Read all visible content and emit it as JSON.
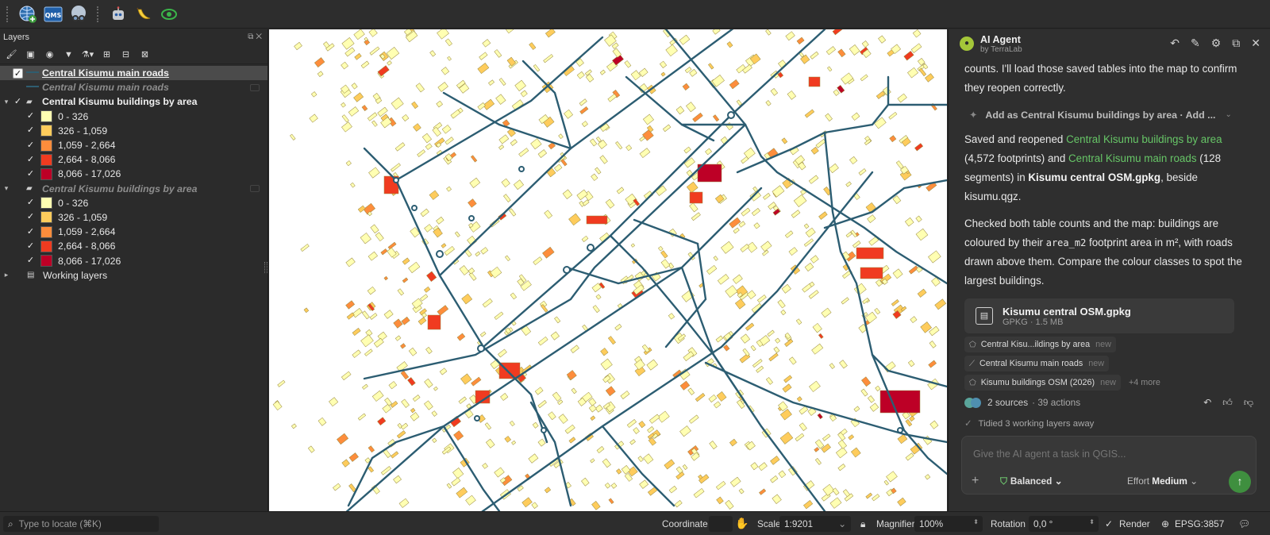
{
  "toolbar": {
    "icons": [
      "globe-add-icon",
      "qms-icon",
      "sphere-binoculars-icon",
      "robot-icon",
      "banana-icon",
      "eye-target-icon"
    ],
    "qms_text": "QMS"
  },
  "layers_panel": {
    "title": "Layers",
    "tree": [
      {
        "label": "Central Kisumu main roads",
        "checked": true,
        "style": "selected"
      },
      {
        "label": "Central Kisumu main roads",
        "checked": false,
        "style": "ghost"
      },
      {
        "label": "Central Kisumu buildings by area",
        "checked": true,
        "style": "bold"
      },
      {
        "label": "Central Kisumu buildings by area",
        "checked": false,
        "style": "ghost"
      },
      {
        "label": "Working layers"
      }
    ],
    "classes": [
      {
        "label": "0 - 326",
        "color": "#ffffb2"
      },
      {
        "label": "326 - 1,059",
        "color": "#fecc5c"
      },
      {
        "label": "1,059 - 2,664",
        "color": "#fd8d3c"
      },
      {
        "label": "2,664 - 8,066",
        "color": "#f03b20"
      },
      {
        "label": "8,066 - 17,026",
        "color": "#bd0026"
      }
    ]
  },
  "agent": {
    "name": "AI Agent",
    "by": "by TerraLab",
    "intro": "counts. I'll load those saved tables into the map to confirm they reopen correctly.",
    "tool_step": "Add as Central Kisumu buildings by area · Add ...",
    "msg1": {
      "p1": "Saved and reopened ",
      "link1": "Central Kisumu buildings by area",
      "p2": " (4,572 footprints) and ",
      "link2": "Central Kisumu main roads",
      "p3": " (128 segments) in ",
      "file": "Kisumu central OSM.gpkg",
      "p4": ", beside kisumu.qgz."
    },
    "msg2": {
      "p1": "Checked both table counts and the map: buildings are coloured by their ",
      "code": "area_m2",
      "p2": " footprint area in m², with roads drawn above them. Compare the colour classes to spot the largest buildings."
    },
    "file_card": {
      "name": "Kisumu central OSM.gpkg",
      "meta": "GPKG · 1.5 MB"
    },
    "chips": [
      {
        "label": "Central Kisu...ildings by area",
        "tag": "new",
        "icon": "polygon-icon"
      },
      {
        "label": "Central Kisumu main roads",
        "tag": "new",
        "icon": "line-icon"
      },
      {
        "label": "Kisumu buildings OSM (2026)",
        "tag": "new",
        "icon": "polygon-icon"
      }
    ],
    "more": "+4 more",
    "sources": "2 sources",
    "actions": "· 39 actions",
    "tidied": "Tidied 3 working layers away",
    "input_placeholder": "Give the AI agent a task in QGIS...",
    "mode": "Balanced",
    "effort_label": "Effort",
    "effort_value": "Medium"
  },
  "statusbar": {
    "locate_placeholder": "Type to locate (⌘K)",
    "coordinate_label": "Coordinate",
    "scale_label": "Scale",
    "scale_value": "1:9201",
    "magnifier_label": "Magnifier",
    "magnifier_value": "100%",
    "rotation_label": "Rotation",
    "rotation_value": "0,0 °",
    "render_label": "Render",
    "crs": "EPSG:3857"
  }
}
